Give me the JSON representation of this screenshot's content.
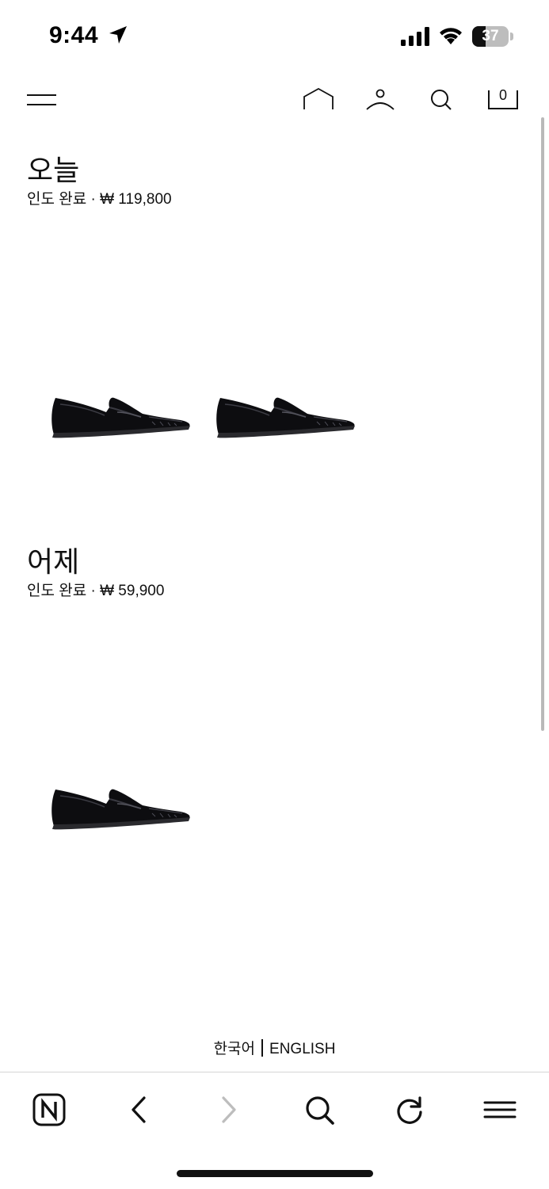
{
  "status_bar": {
    "time": "9:44",
    "battery_percent": 37,
    "icons": [
      "location-arrow-icon",
      "cellular-signal-icon",
      "wifi-icon",
      "battery-icon"
    ]
  },
  "header": {
    "icons": [
      "hamburger-menu-icon",
      "home-icon",
      "account-icon",
      "search-icon",
      "cart-icon"
    ],
    "cart_count": "0"
  },
  "orders": [
    {
      "title": "오늘",
      "status": "인도 완료",
      "separator": "·",
      "price": "₩ 119,800",
      "items": [
        "black-penny-loafer",
        "black-penny-loafer"
      ]
    },
    {
      "title": "어제",
      "status": "인도 완료",
      "separator": "·",
      "price": "₩ 59,900",
      "items": [
        "black-penny-loafer"
      ]
    }
  ],
  "language": {
    "korean": "한국어",
    "english": "ENGLISH"
  },
  "browser_toolbar": {
    "icons": [
      "naver-n-icon",
      "back-arrow-icon",
      "forward-arrow-icon",
      "search-icon",
      "reload-icon",
      "menu-icon"
    ],
    "forward_enabled": false
  },
  "colors": {
    "text": "#111111",
    "disabled": "#bdbdbd",
    "divider": "#d6d6d6"
  }
}
